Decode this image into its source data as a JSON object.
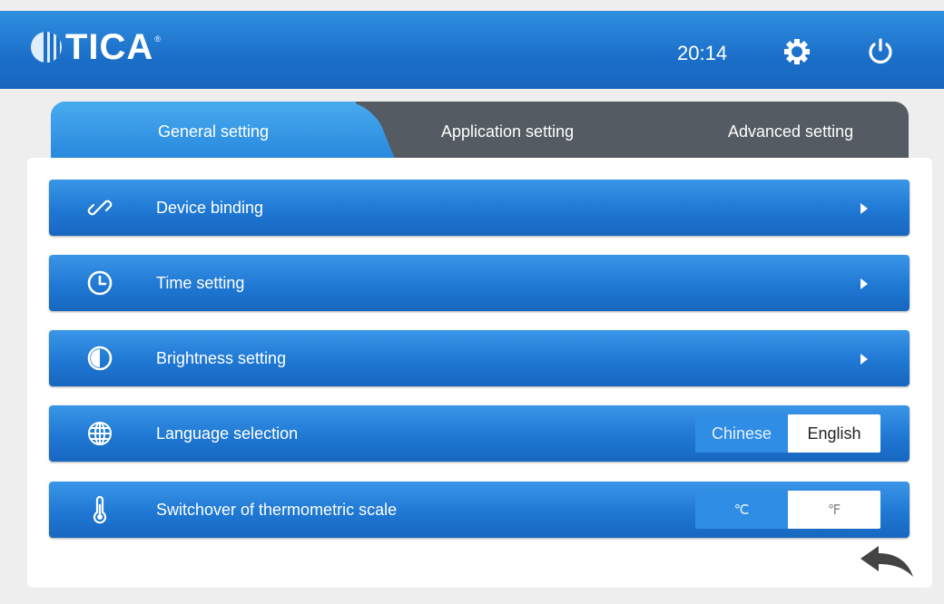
{
  "header": {
    "brand": "TICA",
    "brand_mark": "®",
    "time": "20:14",
    "settings_icon": "gear-icon",
    "power_icon": "power-icon"
  },
  "tabs": [
    {
      "label": "General setting",
      "active": true
    },
    {
      "label": "Application setting",
      "active": false
    },
    {
      "label": "Advanced setting",
      "active": false
    }
  ],
  "rows": [
    {
      "label": "Device binding",
      "icon": "link-icon"
    },
    {
      "label": "Time setting",
      "icon": "clock-icon"
    },
    {
      "label": "Brightness setting",
      "icon": "brightness-icon"
    },
    {
      "label": "Language selection",
      "icon": "globe-icon",
      "options": [
        "Chinese",
        "English"
      ],
      "selected": "English"
    },
    {
      "label": "Switchover of thermometric scale",
      "icon": "thermometer-icon",
      "options": [
        "℃",
        "℉"
      ],
      "selected": "℉"
    }
  ],
  "colors": {
    "header": "#1b6fc9",
    "tab_active": "#2888dd",
    "tab_inactive": "#545b62",
    "row": "#1f78d3",
    "background": "#eeeeee"
  },
  "footer": {
    "back_icon": "back-arrow-icon"
  }
}
